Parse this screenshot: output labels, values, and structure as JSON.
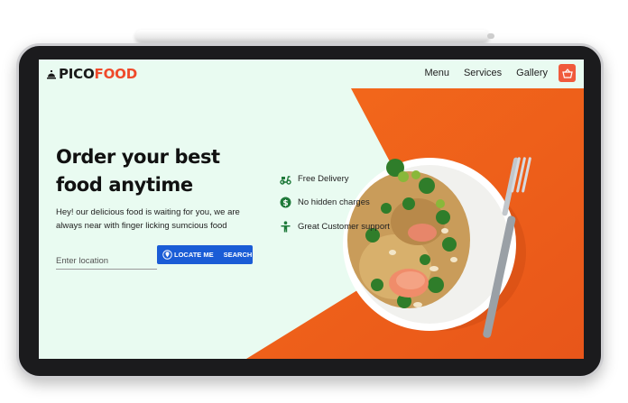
{
  "brand": {
    "logo_part1": "PICO",
    "logo_part2": "FOOD"
  },
  "nav": {
    "items": [
      "Menu",
      "Services",
      "Gallery"
    ]
  },
  "hero": {
    "title": "Order your best food anytime",
    "subtitle": "Hey! our delicious food is waiting for you, we are always near with finger licking sumcious food"
  },
  "search": {
    "placeholder": "Enter location",
    "locate_label": "LOCATE ME",
    "search_label": "SEARCH"
  },
  "features": [
    "Free Delivery",
    "No hidden charges",
    "Great Customer support"
  ],
  "colors": {
    "mint_bg": "#e9fbf1",
    "accent_orange": "#ef4a2b",
    "button_blue": "#1a5cd6",
    "feature_green": "#1f7a3a"
  },
  "icons": {
    "logo": "food-dish-icon",
    "cart": "basket-icon",
    "locate": "location-pin-icon",
    "features": [
      "scooter-icon",
      "dollar-icon",
      "person-icon"
    ]
  }
}
